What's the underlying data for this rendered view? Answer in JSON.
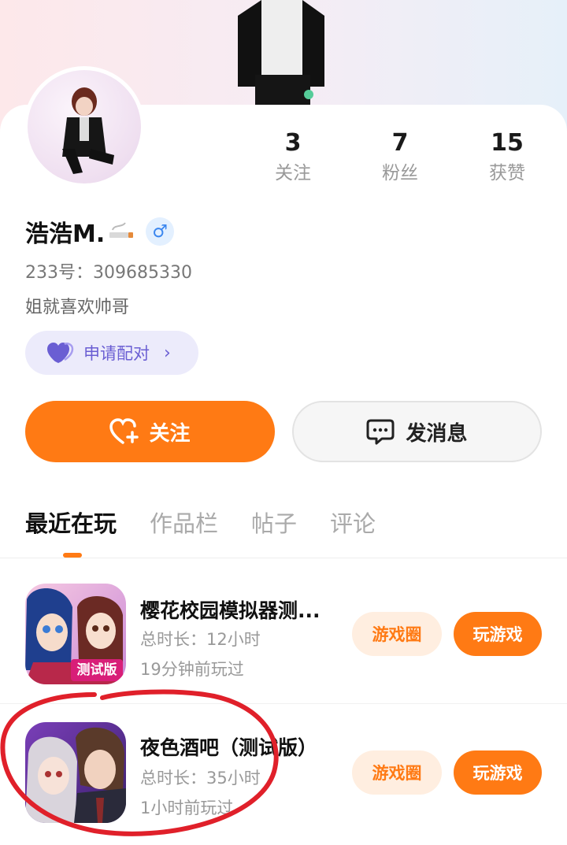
{
  "profile": {
    "name": "浩浩M.",
    "gender_symbol": "♂",
    "uid": "233号：309685330",
    "bio": "姐就喜欢帅哥"
  },
  "stats": [
    {
      "value": "3",
      "label": "关注"
    },
    {
      "value": "7",
      "label": "粉丝"
    },
    {
      "value": "15",
      "label": "获赞"
    }
  ],
  "pair_button": {
    "label": "申请配对",
    "chevron": "›"
  },
  "actions": {
    "follow_label": "关注",
    "message_label": "发消息"
  },
  "tabs": [
    {
      "label": "最近在玩",
      "active": true
    },
    {
      "label": "作品栏",
      "active": false
    },
    {
      "label": "帖子",
      "active": false
    },
    {
      "label": "评论",
      "active": false
    }
  ],
  "games": [
    {
      "title": "樱花校园模拟器测...",
      "duration": "总时长：12小时",
      "last_played": "19分钟前玩过",
      "icon_badge": "测试版",
      "circle_label": "游戏圈",
      "play_label": "玩游戏"
    },
    {
      "title": "夜色酒吧（测试版）",
      "duration": "总时长：35小时",
      "last_played": "1小时前玩过",
      "circle_label": "游戏圈",
      "play_label": "玩游戏"
    }
  ],
  "colors": {
    "accent": "#ff7a14",
    "accent_light": "#ffeee0",
    "pair_purple": "#6a5ed3",
    "gender_blue": "#3a86ef",
    "annotation_red": "#e0202a"
  },
  "icons": [
    "cigarette-icon",
    "male-icon",
    "heart-icon",
    "follow-heart-icon",
    "message-icon",
    "chevron-right-icon"
  ]
}
